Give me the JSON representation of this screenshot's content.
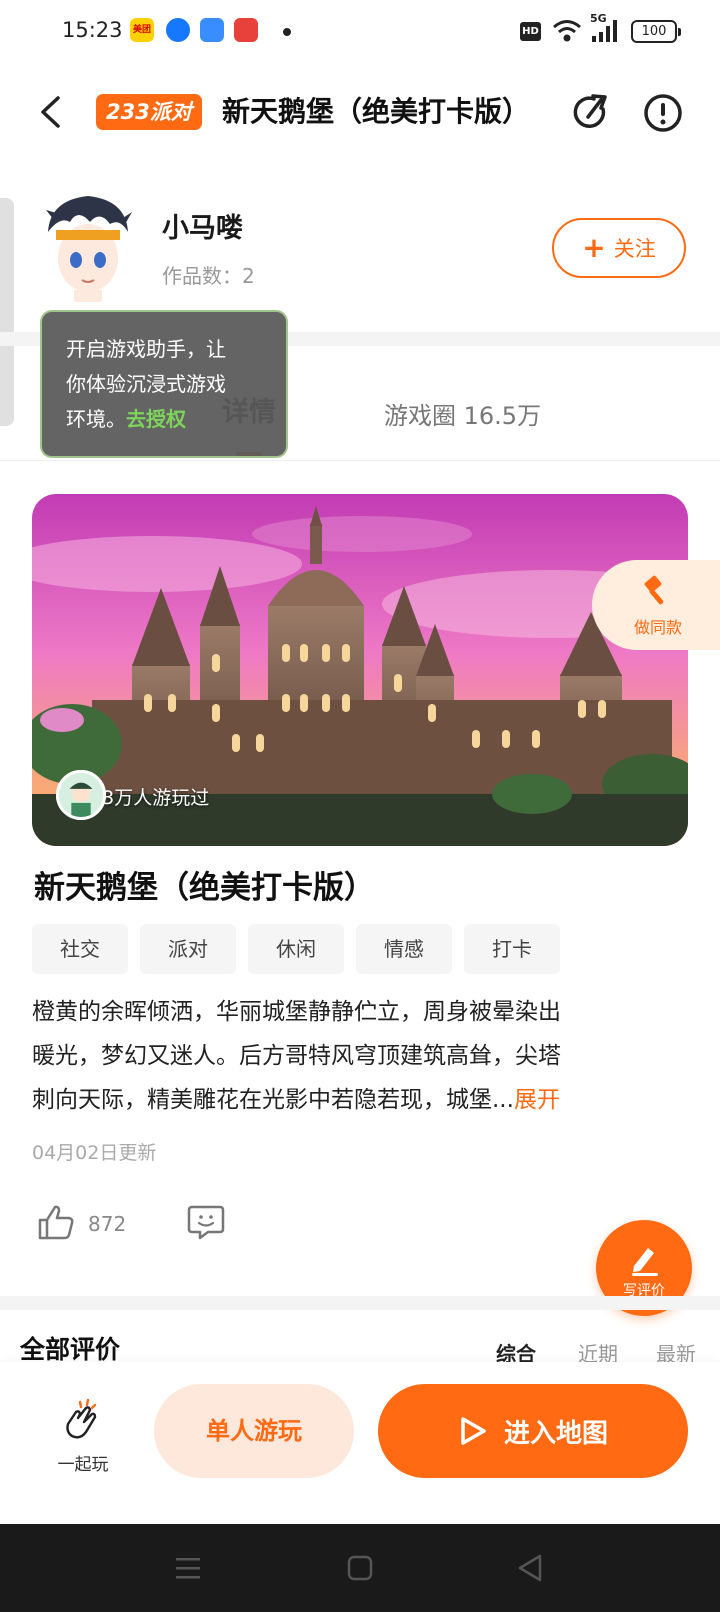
{
  "status_bar": {
    "time": "15:23",
    "apps": [
      {
        "icon": "meituan-icon",
        "label": "美团",
        "color": "#ffd100"
      },
      {
        "icon": "app-blue-circle-icon",
        "label": "",
        "color": "#1677ff"
      },
      {
        "icon": "app-feather-icon",
        "label": "",
        "color": "#3a8dff"
      },
      {
        "icon": "app-red-heart-icon",
        "label": "",
        "color": "#e8413c"
      }
    ],
    "hd": "HD",
    "network": "5G",
    "battery": "100"
  },
  "header": {
    "brand": "233派对",
    "title": "新天鹅堡（绝美打卡版）"
  },
  "author": {
    "name": "小马喽",
    "works": "作品数：2",
    "follow_label": "关注"
  },
  "tabs": {
    "details": "详情",
    "circle": "游戏圈 16.5万"
  },
  "tooltip": {
    "line1": "开启游戏助手，让",
    "line2": "你体验沉浸式游戏",
    "line3": "环境。",
    "link": "去授权"
  },
  "hero": {
    "players_text": "4.3万人游玩过",
    "remix_label": "做同款"
  },
  "game": {
    "title": "新天鹅堡（绝美打卡版）",
    "tags": [
      "社交",
      "派对",
      "休闲",
      "情感",
      "打卡"
    ],
    "desc_line1": "橙黄的余晖倾洒，华丽城堡静静伫立，周身被晕染出",
    "desc_line2": "暖光，梦幻又迷人。后方哥特风穹顶建筑高耸，尖塔",
    "desc_line3": "刺向天际，精美雕花在光影中若隐若现，城堡...",
    "expand": "展开",
    "update": "04月02日更新",
    "likes": "872",
    "write_review": "写评价"
  },
  "reviews": {
    "title": "全部评价",
    "sort": [
      "综合",
      "近期",
      "最新"
    ]
  },
  "bottom_bar": {
    "play_together": "一起玩",
    "solo": "单人游玩",
    "enter": "进入地图"
  },
  "colors": {
    "accent": "#ff6a13",
    "accent_light": "#fee8dc"
  }
}
